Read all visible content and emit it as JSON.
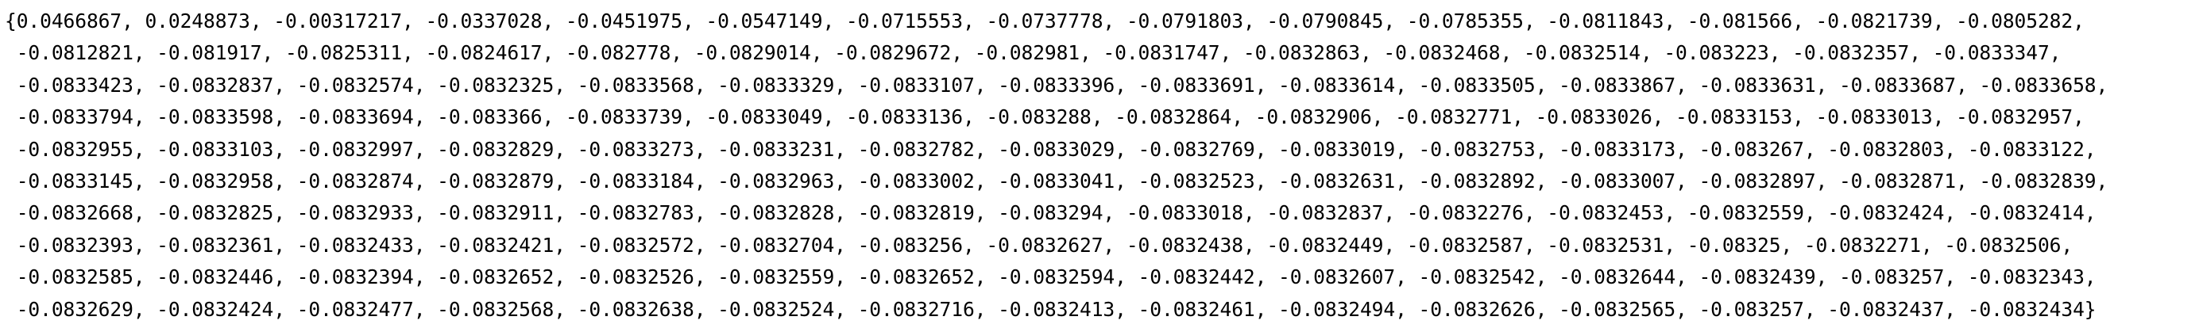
{
  "output": {
    "lines": [
      "{0.0466867, 0.0248873, -0.00317217, -0.0337028, -0.0451975, -0.0547149, -0.0715553, -0.0737778, -0.0791803, -0.0790845, -0.0785355, -0.0811843, -0.081566, -0.0821739, -0.0805282,",
      " -0.0812821, -0.081917, -0.0825311, -0.0824617, -0.082778, -0.0829014, -0.0829672, -0.082981, -0.0831747, -0.0832863, -0.0832468, -0.0832514, -0.083223, -0.0832357, -0.0833347,",
      " -0.0833423, -0.0832837, -0.0832574, -0.0832325, -0.0833568, -0.0833329, -0.0833107, -0.0833396, -0.0833691, -0.0833614, -0.0833505, -0.0833867, -0.0833631, -0.0833687, -0.0833658,",
      " -0.0833794, -0.0833598, -0.0833694, -0.083366, -0.0833739, -0.0833049, -0.0833136, -0.083288, -0.0832864, -0.0832906, -0.0832771, -0.0833026, -0.0833153, -0.0833013, -0.0832957,",
      " -0.0832955, -0.0833103, -0.0832997, -0.0832829, -0.0833273, -0.0833231, -0.0832782, -0.0833029, -0.0832769, -0.0833019, -0.0832753, -0.0833173, -0.083267, -0.0832803, -0.0833122,",
      " -0.0833145, -0.0832958, -0.0832874, -0.0832879, -0.0833184, -0.0832963, -0.0833002, -0.0833041, -0.0832523, -0.0832631, -0.0832892, -0.0833007, -0.0832897, -0.0832871, -0.0832839,",
      " -0.0832668, -0.0832825, -0.0832933, -0.0832911, -0.0832783, -0.0832828, -0.0832819, -0.083294, -0.0833018, -0.0832837, -0.0832276, -0.0832453, -0.0832559, -0.0832424, -0.0832414,",
      " -0.0832393, -0.0832361, -0.0832433, -0.0832421, -0.0832572, -0.0832704, -0.083256, -0.0832627, -0.0832438, -0.0832449, -0.0832587, -0.0832531, -0.08325, -0.0832271, -0.0832506,",
      " -0.0832585, -0.0832446, -0.0832394, -0.0832652, -0.0832526, -0.0832559, -0.0832652, -0.0832594, -0.0832442, -0.0832607, -0.0832542, -0.0832644, -0.0832439, -0.083257, -0.0832343,",
      " -0.0832629, -0.0832424, -0.0832477, -0.0832568, -0.0832638, -0.0832524, -0.0832716, -0.0832413, -0.0832461, -0.0832494, -0.0832626, -0.0832565, -0.083257, -0.0832437, -0.0832434}"
    ]
  }
}
